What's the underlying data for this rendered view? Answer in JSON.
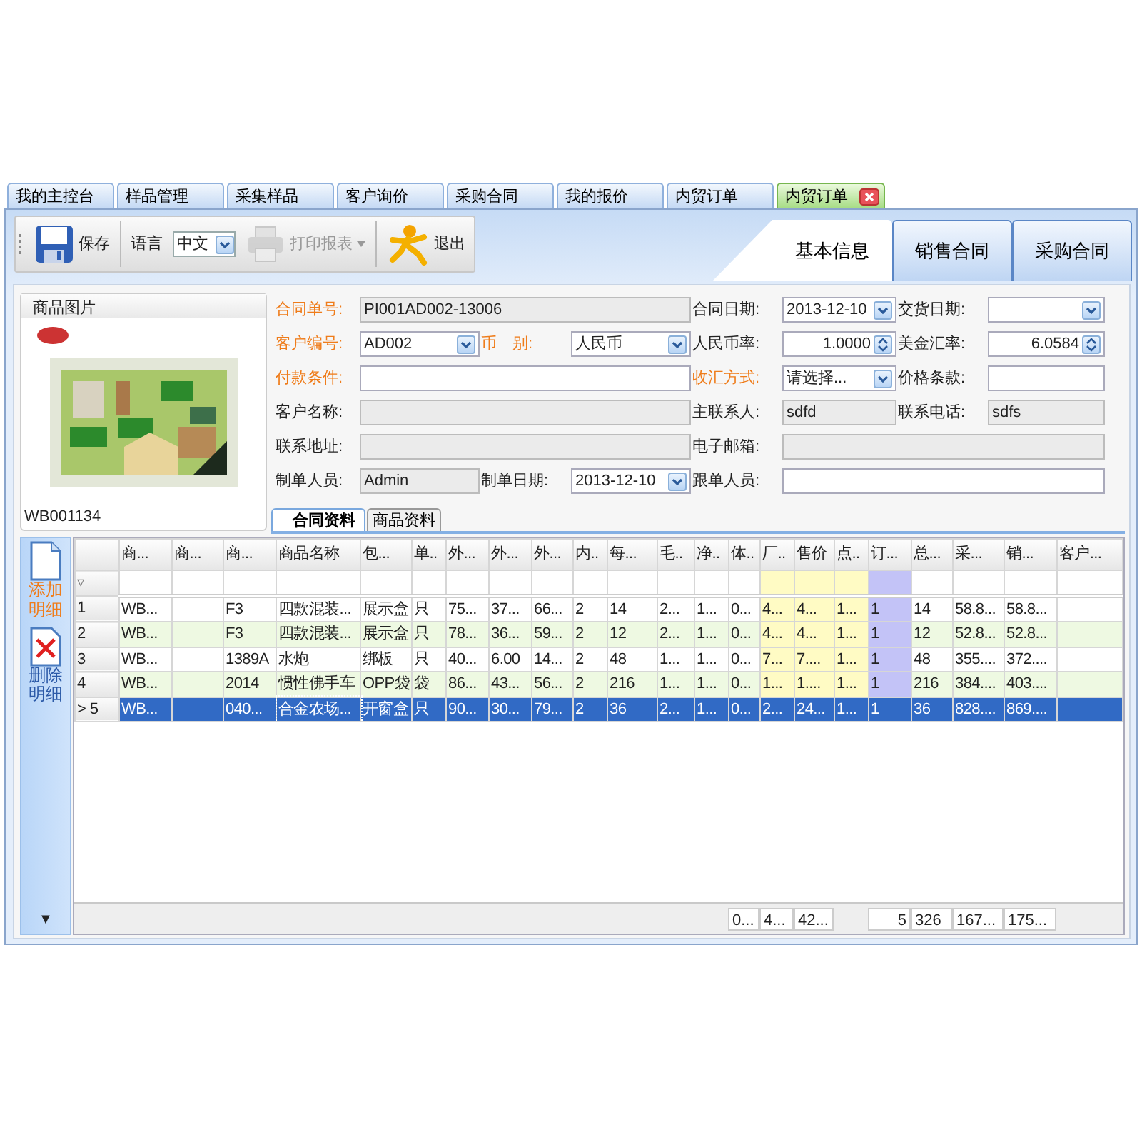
{
  "app_tabs": [
    {
      "label": "我的主控台",
      "selected": false,
      "closable": false
    },
    {
      "label": "样品管理",
      "selected": false,
      "closable": false
    },
    {
      "label": "采集样品",
      "selected": false,
      "closable": false
    },
    {
      "label": "客户询价",
      "selected": false,
      "closable": false
    },
    {
      "label": "采购合同",
      "selected": false,
      "closable": false
    },
    {
      "label": "我的报价",
      "selected": false,
      "closable": false
    },
    {
      "label": "内贸订单",
      "selected": false,
      "closable": false
    },
    {
      "label": "内贸订单",
      "selected": true,
      "closable": true
    }
  ],
  "toolbar": {
    "items": [
      {
        "kind": "button",
        "label": "保存",
        "disabled": false
      },
      {
        "kind": "language",
        "label": "语言",
        "value": "中文"
      },
      {
        "kind": "menu",
        "label": "打印报表",
        "disabled": true
      },
      {
        "kind": "button",
        "label": "退出",
        "disabled": false
      }
    ]
  },
  "section_tabs": [
    {
      "label": "基本信息",
      "selected": true
    },
    {
      "label": "销售合同",
      "selected": false
    },
    {
      "label": "采购合同",
      "selected": false
    }
  ],
  "product_image": {
    "title": "商品图片",
    "kind": "picture",
    "code": "WB001134"
  },
  "form": {
    "rows": [
      [
        {
          "label": "合同单号:",
          "kind": "readonly",
          "required": true,
          "value": "PI001AD002-13006"
        },
        {
          "label": "合同日期:",
          "kind": "combo",
          "required": false,
          "value": "2013-12-10"
        },
        {
          "label": "交货日期:",
          "kind": "combo",
          "required": false
        }
      ],
      [
        {
          "label": "客户编号:",
          "kind": "combo",
          "required": true,
          "value": "AD002"
        },
        {
          "label": "币　别:",
          "kind": "combo",
          "required": true,
          "value": "人民币"
        },
        {
          "label": "人民币率:",
          "kind": "spinner",
          "required": false,
          "value": "1.0000"
        },
        {
          "label": "美金汇率:",
          "kind": "spinner",
          "required": false,
          "value": "6.0584"
        }
      ],
      [
        {
          "label": "付款条件:",
          "kind": "text",
          "required": true
        },
        {
          "label": "收汇方式:",
          "kind": "combo",
          "required": true,
          "value": "请选择..."
        },
        {
          "label": "价格条款:",
          "kind": "text",
          "required": false
        }
      ],
      [
        {
          "label": "客户名称:",
          "kind": "readonly",
          "required": false
        },
        {
          "label": "主联系人:",
          "kind": "readonly",
          "required": false,
          "value": "sdfd"
        },
        {
          "label": "联系电话:",
          "kind": "readonly",
          "required": false,
          "value": "sdfs"
        }
      ],
      [
        {
          "label": "联系地址:",
          "kind": "readonly",
          "required": false
        },
        {
          "label": "电子邮箱:",
          "kind": "readonly",
          "required": false
        }
      ],
      [
        {
          "label": "制单人员:",
          "kind": "readonly",
          "required": false,
          "value": "Admin"
        },
        {
          "label": "制单日期:",
          "kind": "combo",
          "required": false,
          "value": "2013-12-10"
        },
        {
          "label": "跟单人员:",
          "kind": "text",
          "required": false
        }
      ]
    ]
  },
  "detail_tabs": [
    {
      "label": "合同资料",
      "selected": true
    },
    {
      "label": "商品资料",
      "selected": false
    }
  ],
  "side_actions": [
    {
      "label": "添加明细",
      "kind": "add"
    },
    {
      "label": "删除明细",
      "kind": "delete"
    }
  ],
  "side_scroll": "▼",
  "table": {
    "columns": [
      {
        "label": "商...",
        "kind": "plain"
      },
      {
        "label": "商...",
        "kind": "plain"
      },
      {
        "label": "商...",
        "kind": "plain"
      },
      {
        "label": "商品名称",
        "kind": "plain"
      },
      {
        "label": "包...",
        "kind": "plain"
      },
      {
        "label": "单..",
        "kind": "plain"
      },
      {
        "label": "外...",
        "kind": "plain"
      },
      {
        "label": "外...",
        "kind": "plain"
      },
      {
        "label": "外...",
        "kind": "plain"
      },
      {
        "label": "内..",
        "kind": "plain"
      },
      {
        "label": "每...",
        "kind": "plain"
      },
      {
        "label": "毛..",
        "kind": "plain"
      },
      {
        "label": "净..",
        "kind": "plain"
      },
      {
        "label": "体..",
        "kind": "plain",
        "total": "0..."
      },
      {
        "label": "厂..",
        "kind": "price",
        "total": "4..."
      },
      {
        "label": "售价",
        "kind": "price",
        "total": "42..."
      },
      {
        "label": "点..",
        "kind": "price"
      },
      {
        "label": "订...",
        "kind": "order",
        "total": "5"
      },
      {
        "label": "总...",
        "kind": "plain",
        "total": "326"
      },
      {
        "label": "采...",
        "kind": "plain",
        "total": "167..."
      },
      {
        "label": "销...",
        "kind": "plain",
        "total": "175..."
      },
      {
        "label": "客户...",
        "kind": "plain"
      }
    ],
    "filter_icon": "▿",
    "rows": [
      {
        "number": "1",
        "selected": false,
        "cells": {
          "1": "WB...",
          "3": "F3",
          "4": "四款混装...",
          "5": "展示盒",
          "6": "只",
          "7": "75...",
          "8": "37...",
          "9": "66...",
          "10": "2",
          "11": "14",
          "12": "2...",
          "13": "1...",
          "14": "0...",
          "15": "4...",
          "16": "4...",
          "17": "1...",
          "18": "1",
          "19": "14",
          "20": "58.8...",
          "21": "58.8..."
        }
      },
      {
        "number": "2",
        "selected": false,
        "cells": {
          "1": "WB...",
          "3": "F3",
          "4": "四款混装...",
          "5": "展示盒",
          "6": "只",
          "7": "78...",
          "8": "36...",
          "9": "59...",
          "10": "2",
          "11": "12",
          "12": "2...",
          "13": "1...",
          "14": "0...",
          "15": "4...",
          "16": "4...",
          "17": "1...",
          "18": "1",
          "19": "12",
          "20": "52.8...",
          "21": "52.8..."
        }
      },
      {
        "number": "3",
        "selected": false,
        "cells": {
          "1": "WB...",
          "3": "1389A",
          "4": "水炮",
          "5": "绑板",
          "6": "只",
          "7": "40...",
          "8": "6.00",
          "9": "14...",
          "10": "2",
          "11": "48",
          "12": "1...",
          "13": "1...",
          "14": "0...",
          "15": "7...",
          "16": "7....",
          "17": "1...",
          "18": "1",
          "19": "48",
          "20": "355....",
          "21": "372...."
        }
      },
      {
        "number": "4",
        "selected": false,
        "cells": {
          "1": "WB...",
          "3": "2014",
          "4": "惯性佛手车",
          "5": "OPP袋",
          "6": "袋",
          "7": "86...",
          "8": "43...",
          "9": "56...",
          "10": "2",
          "11": "216",
          "12": "1...",
          "13": "1...",
          "14": "0...",
          "15": "1...",
          "16": "1....",
          "17": "1...",
          "18": "1",
          "19": "216",
          "20": "384....",
          "21": "403...."
        }
      },
      {
        "number": "5",
        "indicator": ">",
        "selected": true,
        "cells": {
          "1": "WB...",
          "3": "040...",
          "4": "合金农场...",
          "5": "开窗盒",
          "6": "只",
          "7": "90...",
          "8": "30...",
          "9": "79...",
          "10": "2",
          "11": "36",
          "12": "2...",
          "13": "1...",
          "14": "0...",
          "15": "2...",
          "16": "24...",
          "17": "1...",
          "18": "1",
          "19": "36",
          "20": "828....",
          "21": "869...."
        }
      }
    ]
  }
}
